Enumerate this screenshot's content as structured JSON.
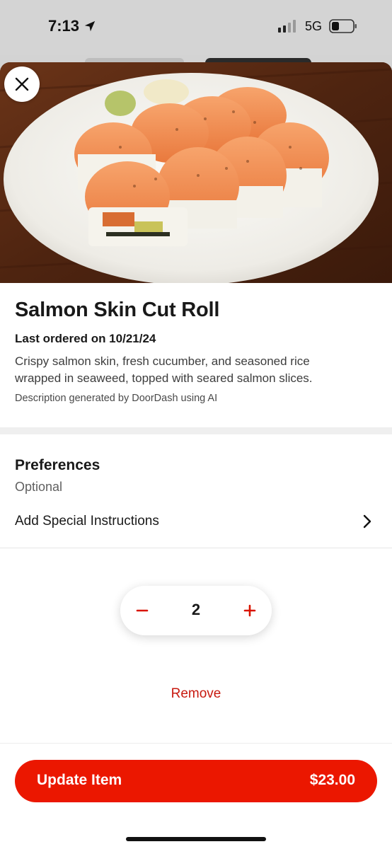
{
  "status_bar": {
    "time": "7:13",
    "network": "5G",
    "icons": [
      "location-arrow-icon",
      "signal-bars-icon",
      "battery-icon"
    ]
  },
  "hero": {
    "image": "salmon-sushi-roll-photo"
  },
  "item": {
    "title": "Salmon Skin Cut Roll",
    "last_ordered": "Last ordered on 10/21/24",
    "description": "Crispy salmon skin, fresh cucumber, and seasoned rice wrapped in seaweed, topped with seared salmon slices.",
    "ai_note": "Description generated by DoorDash using AI"
  },
  "preferences": {
    "title": "Preferences",
    "subtitle": "Optional",
    "special_instructions_label": "Add Special Instructions"
  },
  "quantity": {
    "value": "2",
    "minus_symbol": "−",
    "plus_symbol": "+"
  },
  "remove_label": "Remove",
  "cta": {
    "label": "Update Item",
    "price": "$23.00"
  },
  "colors": {
    "brand_red": "#eb1700",
    "remove_red": "#c8190f"
  }
}
